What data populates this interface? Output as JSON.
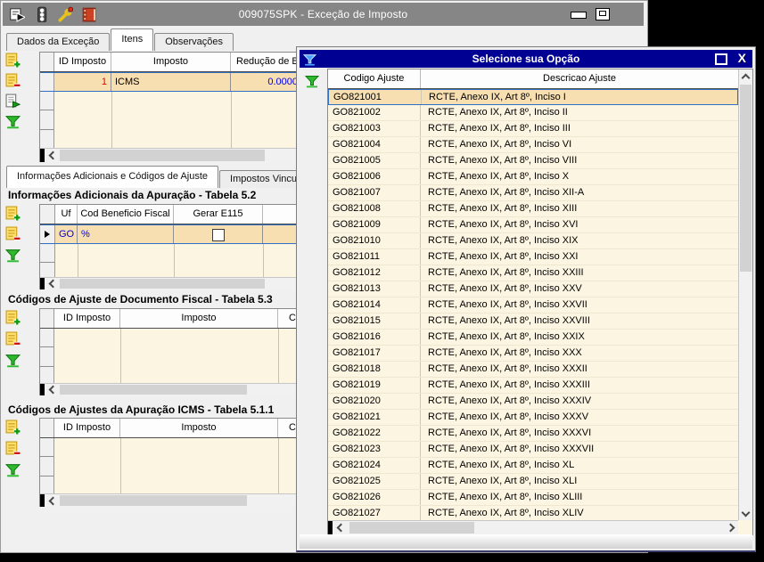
{
  "colors": {
    "desktop_bg": "#000000",
    "main_titlebar_bg": "#868686",
    "window_bg": "#f0f0f0",
    "grid_body_bg": "#fcf5e2",
    "selected_row_bg": "#f8dfb1",
    "selection_border": "#2f6fc4",
    "popup_titlebar_bg": "#000092",
    "value_blue": "#0000e6",
    "value_red": "#e00000"
  },
  "icons": {
    "titlebar": [
      "form-arrow-icon",
      "traffic-light-icon",
      "wrench-icon",
      "book-icon"
    ],
    "grid_toolbar": [
      "add-record-icon",
      "delete-record-icon",
      "post-record-icon",
      "filter-icon"
    ],
    "popup": [
      "filter-icon"
    ]
  },
  "main_window": {
    "title": "009075SPK - Exceção de Imposto",
    "tabs": [
      {
        "label": "Dados da Exceção"
      },
      {
        "label": "Itens"
      },
      {
        "label": "Observações"
      }
    ],
    "itens_grid": {
      "columns": [
        "ID Imposto",
        "Imposto",
        "Redução de Ba"
      ],
      "row": {
        "id_imposto": "1",
        "imposto": "ICMS",
        "reducao": "0.0000"
      }
    },
    "inner_tabs": [
      {
        "label": "Informações Adicionais e Códigos de Ajuste"
      },
      {
        "label": "Impostos Vinculad"
      }
    ],
    "section_52": {
      "title": "Informações Adicionais da Apuração - Tabela 5.2",
      "columns": [
        "Uf",
        "Cod Beneficio Fiscal",
        "Gerar E115"
      ],
      "row": {
        "uf": "GO",
        "cod_beneficio": "%",
        "gerar_e115_checked": false
      }
    },
    "section_53": {
      "title": "Códigos de Ajuste de Documento Fiscal - Tabela 5.3",
      "columns": [
        "ID Imposto",
        "Imposto",
        "C"
      ]
    },
    "section_511": {
      "title": "Códigos de Ajustes da Apuração ICMS - Tabela 5.1.1",
      "columns": [
        "ID Imposto",
        "Imposto",
        "C"
      ]
    }
  },
  "popup": {
    "title": "Selecione sua Opção",
    "columns": [
      "Codigo Ajuste",
      "Descricao Ajuste"
    ],
    "rows": [
      [
        "GO821001",
        "RCTE, Anexo IX, Art 8º, Inciso I"
      ],
      [
        "GO821002",
        "RCTE, Anexo IX, Art 8º, Inciso II"
      ],
      [
        "GO821003",
        "RCTE, Anexo IX, Art 8º, Inciso III"
      ],
      [
        "GO821004",
        "RCTE, Anexo IX, Art 8º, Inciso VI"
      ],
      [
        "GO821005",
        "RCTE, Anexo IX, Art 8º, Inciso VIII"
      ],
      [
        "GO821006",
        "RCTE, Anexo IX, Art 8º, Inciso X"
      ],
      [
        "GO821007",
        "RCTE, Anexo IX, Art 8º, Inciso XII-A"
      ],
      [
        "GO821008",
        "RCTE, Anexo IX, Art 8º, Inciso XIII"
      ],
      [
        "GO821009",
        "RCTE, Anexo IX, Art 8º, Inciso XVI"
      ],
      [
        "GO821010",
        "RCTE, Anexo IX, Art 8º, Inciso XIX"
      ],
      [
        "GO821011",
        "RCTE, Anexo IX, Art 8º, Inciso XXI"
      ],
      [
        "GO821012",
        "RCTE, Anexo IX, Art 8º, Inciso XXIII"
      ],
      [
        "GO821013",
        "RCTE, Anexo IX, Art 8º, Inciso XXV"
      ],
      [
        "GO821014",
        "RCTE, Anexo IX, Art 8º, Inciso XXVII"
      ],
      [
        "GO821015",
        "RCTE, Anexo IX, Art 8º, Inciso XXVIII"
      ],
      [
        "GO821016",
        "RCTE, Anexo IX, Art 8º, Inciso XXIX"
      ],
      [
        "GO821017",
        "RCTE, Anexo IX, Art 8º, Inciso XXX"
      ],
      [
        "GO821018",
        "RCTE, Anexo IX, Art 8º, Inciso XXXII"
      ],
      [
        "GO821019",
        "RCTE, Anexo IX, Art 8º, Inciso XXXIII"
      ],
      [
        "GO821020",
        "RCTE, Anexo IX, Art 8º, Inciso XXXIV"
      ],
      [
        "GO821021",
        "RCTE, Anexo IX, Art 8º, Inciso XXXV"
      ],
      [
        "GO821022",
        "RCTE, Anexo IX, Art 8º, Inciso XXXVI"
      ],
      [
        "GO821023",
        "RCTE, Anexo IX, Art 8º, Inciso XXXVII"
      ],
      [
        "GO821024",
        "RCTE, Anexo IX, Art 8º, Inciso XL"
      ],
      [
        "GO821025",
        "RCTE, Anexo IX, Art 8º, Inciso XLI"
      ],
      [
        "GO821026",
        "RCTE, Anexo IX, Art 8º, Inciso XLIII"
      ],
      [
        "GO821027",
        "RCTE, Anexo IX, Art 8º, Inciso XLIV"
      ]
    ]
  }
}
